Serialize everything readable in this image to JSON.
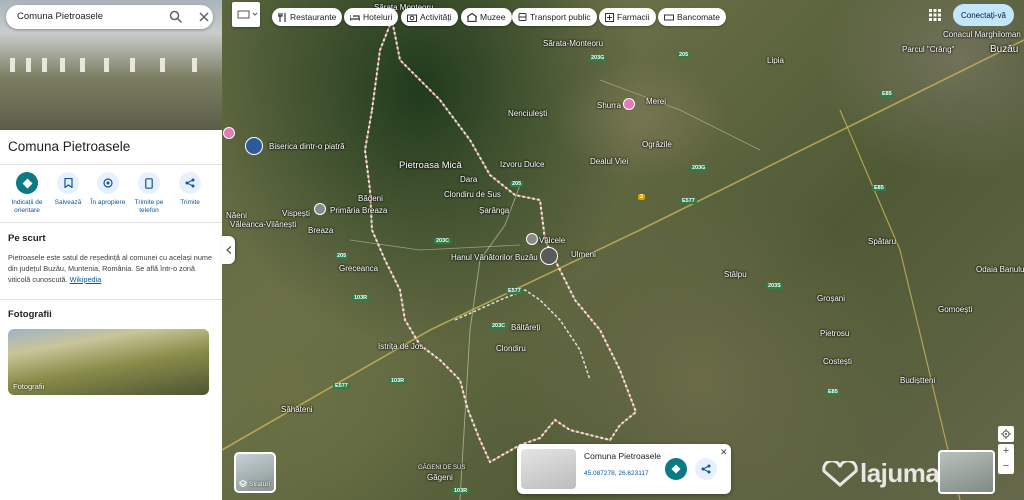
{
  "search": {
    "value": "Comuna Pietroasele"
  },
  "place": {
    "title": "Comuna Pietroasele",
    "actions": [
      {
        "label": "Indicații de orientare"
      },
      {
        "label": "Salvează"
      },
      {
        "label": "În apropiere"
      },
      {
        "label": "Trimite pe telefon"
      },
      {
        "label": "Trimite"
      }
    ],
    "summary_title": "Pe scurt",
    "summary_text": "Pietroasele este satul de reședință al comunei cu același nume din județul Buzău, Muntenia, România. Se află într-o zonă viticolă cunoscută.",
    "summary_link": "Wikipedia",
    "photos_title": "Fotografii",
    "photos_label": "Fotografii"
  },
  "chips": [
    {
      "label": "Restaurante",
      "icon": "fork-knife-icon"
    },
    {
      "label": "Hoteluri",
      "icon": "bed-icon"
    },
    {
      "label": "Activități",
      "icon": "camera-icon"
    },
    {
      "label": "Muzee",
      "icon": "museum-icon"
    },
    {
      "label": "Transport public",
      "icon": "bus-icon"
    },
    {
      "label": "Farmacii",
      "icon": "pharmacy-icon"
    },
    {
      "label": "Bancomate",
      "icon": "atm-icon"
    }
  ],
  "header": {
    "signin": "Conectați-vă"
  },
  "layers": {
    "label": "Straturi"
  },
  "infocard": {
    "title": "Comuna Pietroasele",
    "coords": "45.087278, 26.623117"
  },
  "map_labels": {
    "sarata_monteoru": "Sărata-Monteoru",
    "sarata_monteoru_top": "Sărata Monteoru",
    "lipia": "Lipia",
    "parcul_crang": "Parcul \"Crâng\"",
    "conacul": "Conacul Marghiloman",
    "buzau": "Buzău",
    "nenciulesti": "Nenciulești",
    "shurra": "Shurra",
    "merei": "Merei",
    "ograzile": "Ogrăzile",
    "dealul_viei": "Dealul Viei",
    "biserica": "Biserica dintr-o piatră",
    "pietroasa_mica": "Pietroasa Mică",
    "izvoru_dulce": "Izvoru Dulce",
    "dara": "Dara",
    "clondiru_de_sus": "Clondiru de Sus",
    "badeni": "Bădeni",
    "primaria": "Primăria Breaza",
    "vispesti": "Vispești",
    "valeanca": "Văleanca-Vilănești",
    "naeni": "Năeni",
    "breaza": "Breaza",
    "saranga": "Șarânga",
    "valcele": "Vâlcele",
    "hanul": "Hanul Vânătorilor Buzău",
    "ulmeni": "Ulmeni",
    "greceanca": "Greceanca",
    "spataru": "Spătaru",
    "odaia_banului": "Odaia Banului",
    "stalpu": "Stâlpu",
    "grosani": "Groșani",
    "baltareti": "Băltăreți",
    "clondiru": "Clondiru",
    "pietrosu": "Pietrosu",
    "gomoesti": "Gomoești",
    "istrita": "Istrița de Jos",
    "costesti": "Costești",
    "budistteni": "Budiștteni",
    "sahateni": "Săhăteni",
    "gageni_de_sus": "GĂGENI DE SUS",
    "gageni": "Găgeni"
  },
  "roads": {
    "r203": "203G",
    "r205": "205",
    "r6e85": "E85",
    "r6e577": "E577",
    "r2": "2",
    "r203c": "203C",
    "r103r": "103R",
    "r203g": "203G",
    "r203s": "203S"
  },
  "watermark": "lajumate.ro",
  "colors": {
    "teal": "#0b7a83",
    "link": "#0b57a0",
    "boundary": "#ffffff"
  }
}
